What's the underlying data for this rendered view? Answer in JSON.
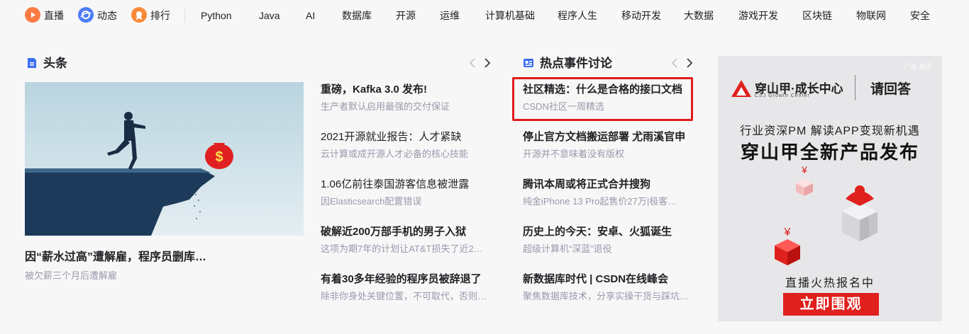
{
  "nav": {
    "items": [
      {
        "label": "直播",
        "icon": "live-icon",
        "color": "#fc7b43"
      },
      {
        "label": "动态",
        "icon": "activity-icon",
        "color": "#4e7cf6"
      },
      {
        "label": "排行",
        "icon": "rank-icon",
        "color": "#fa8a3a"
      }
    ],
    "categories": [
      "Python",
      "Java",
      "AI",
      "数据库",
      "开源",
      "运维",
      "计算机基础",
      "程序人生",
      "移动开发",
      "大数据",
      "游戏开发",
      "区块链",
      "物联网",
      "安全"
    ]
  },
  "headlines": {
    "title": "头条",
    "icon": "document-icon",
    "featured": {
      "title": "因“薪水过高”遭解雇，程序员删库…",
      "desc": "被欠薪三个月后遭解雇",
      "image": "man-jumping-cliff-money-bag-illustration"
    },
    "items": [
      {
        "title": "重磅，Kafka 3.0 发布!",
        "desc": "生产者默认启用最强的交付保证"
      },
      {
        "title": "2021开源就业报告：人才紧缺",
        "desc": "云计算或成开源人才必备的核心技能"
      },
      {
        "title": "1.06亿前往泰国游客信息被泄露",
        "desc": "因Elasticsearch配置错误"
      },
      {
        "title": "破解近200万部手机的男子入狱",
        "desc": "这项为期7年的计划让AT&T损失了近2…"
      },
      {
        "title": "有着30多年经验的程序员被辞退了",
        "desc": "除非你身处关键位置，不可取代，否则…"
      }
    ]
  },
  "hot": {
    "title": "热点事件讨论",
    "icon": "news-card-icon",
    "items": [
      {
        "title": "社区精选：什么是合格的接口文档",
        "desc": "CSDN社区一周精选"
      },
      {
        "title": "停止官方文档搬运部署 尤雨溪官申",
        "desc": "开源并不意味着没有版权"
      },
      {
        "title": "腾讯本周或将正式合并搜狗",
        "desc": "纯金iPhone 13 Pro起售价27万|极客…"
      },
      {
        "title": "历史上的今天：安卓、火狐诞生",
        "desc": "超级计算机“深蓝”退役"
      },
      {
        "title": "新数据库时代 | CSDN在线峰会",
        "desc": "聚焦数据库技术，分享实操干货与踩坑…"
      }
    ]
  },
  "ad": {
    "mark": "广告 关闭",
    "brand": "穿山甲·成长中心",
    "brand_sub": "CSJ Growth Center",
    "brand2": "请回答",
    "line1": "行业资深PM 解读APP变现新机遇",
    "line2": "穿山甲全新产品发布",
    "live": "直播火热报名中",
    "cta": "立即围观"
  },
  "colors": {
    "highlight": "#e21b1b",
    "accent_blue": "#3a6cf4",
    "ad_red": "#e0201c"
  }
}
